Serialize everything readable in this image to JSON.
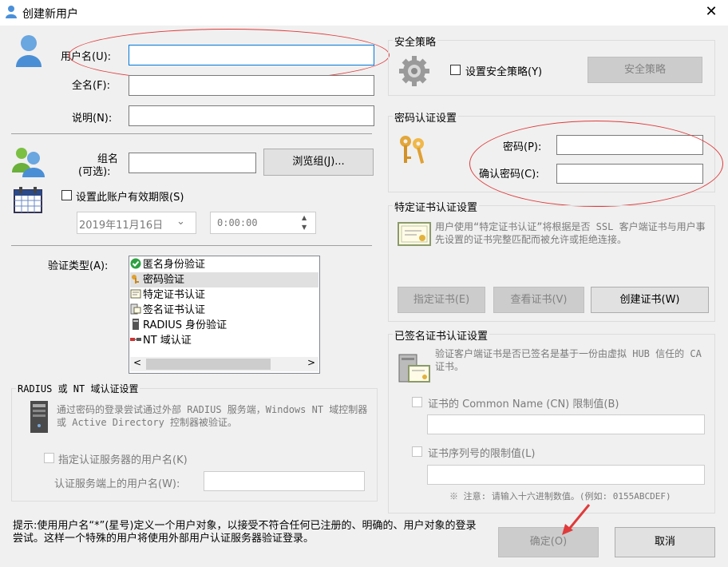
{
  "window": {
    "title": "创建新用户",
    "close_glyph": "✕"
  },
  "user": {
    "username_label": "用户名(U):",
    "username_value": "",
    "fullname_label": "全名(F):",
    "fullname_value": "",
    "description_label": "说明(N):",
    "description_value": ""
  },
  "group": {
    "label_line1": "组名",
    "label_line2": "(可选):",
    "value": "",
    "browse_button": "浏览组(J)..."
  },
  "expiry": {
    "checkbox_label": "设置此账户有效期限(S)",
    "date_value": "2019年11月16日",
    "time_value": "0:00:00"
  },
  "auth_type": {
    "label": "验证类型(A):",
    "items": [
      {
        "label": "匿名身份验证",
        "icon": "check-shield-icon"
      },
      {
        "label": "密码验证",
        "icon": "keys-icon"
      },
      {
        "label": "特定证书认证",
        "icon": "certificate-icon"
      },
      {
        "label": "签名证书认证",
        "icon": "signed-certificate-icon"
      },
      {
        "label": "RADIUS 身份验证",
        "icon": "server-icon"
      },
      {
        "label": "NT 域认证",
        "icon": "domain-icon"
      }
    ],
    "selected_index": 1
  },
  "radius": {
    "title": "RADIUS 或 NT 域认证设置",
    "description": "通过密码的登录尝试通过外部 RADIUS 服务端，Windows NT 域控制器或 Active Directory 控制器被验证。",
    "checkbox_label": "指定认证服务器的用户名(K)",
    "server_user_label": "认证服务端上的用户名(W):",
    "server_user_value": ""
  },
  "security_policy": {
    "title": "安全策略",
    "checkbox_label": "设置安全策略(Y)",
    "button": "安全策略"
  },
  "password": {
    "title": "密码认证设置",
    "password_label": "密码(P):",
    "password_value": "",
    "confirm_label": "确认密码(C):",
    "confirm_value": ""
  },
  "specific_cert": {
    "title": "特定证书认证设置",
    "description": "用户使用“特定证书认证”将根据是否 SSL 客户端证书与用户事先设置的证书完整匹配而被允许或拒绝连接。",
    "assign_button": "指定证书(E)",
    "view_button": "查看证书(V)",
    "create_button": "创建证书(W)"
  },
  "signed_cert": {
    "title": "已签名证书认证设置",
    "description": "验证客户端证书是否已签名是基于一份由虚拟 HUB 信任的 CA 证书。",
    "cn_label": "证书的 Common Name (CN) 限制值(B)",
    "cn_value": "",
    "serial_label": "证书序列号的限制值(L)",
    "serial_value": "",
    "note": "※ 注意: 请输入十六进制数值。(例如: 0155ABCDEF)"
  },
  "footer": {
    "hint": "提示:使用用户名“*”(星号)定义一个用户对象，以接受不符合任何已注册的、明确的、用户对象的登录尝试。这样一个特殊的用户将使用外部用户认证服务器验证登录。",
    "ok_button": "确定(O)",
    "cancel_button": "取消"
  },
  "colors": {
    "annotation_red": "#e03a3a",
    "focus_blue": "#0078d7",
    "dialog_bg": "#f0f0f0"
  }
}
